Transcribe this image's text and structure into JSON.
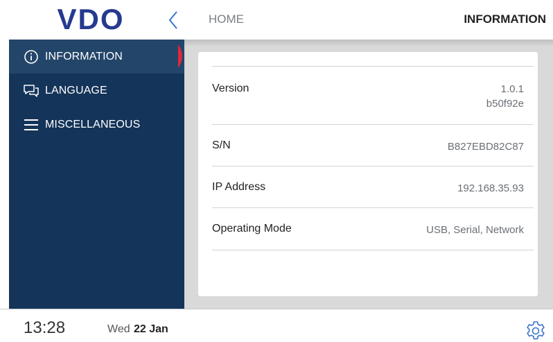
{
  "header": {
    "logo_text": "VDO",
    "breadcrumb_home": "HOME",
    "title": "INFORMATION"
  },
  "sidebar": {
    "items": [
      {
        "label": "INFORMATION",
        "icon": "info-circle-icon",
        "active": true
      },
      {
        "label": "LANGUAGE",
        "icon": "chat-bubbles-icon",
        "active": false
      },
      {
        "label": "MISCELLANEOUS",
        "icon": "menu-lines-icon",
        "active": false
      }
    ]
  },
  "info": {
    "rows": [
      {
        "label": "Version",
        "value": "1.0.1",
        "value2": "b50f92e"
      },
      {
        "label": "S/N",
        "value": "B827EBD82C87"
      },
      {
        "label": "IP Address",
        "value": "192.168.35.93"
      },
      {
        "label": "Operating Mode",
        "value": "USB, Serial, Network"
      }
    ]
  },
  "footer": {
    "time": "13:28",
    "date_day": "Wed",
    "date_rest": "22 Jan"
  },
  "colors": {
    "brand_blue": "#263a8f",
    "sidebar_bg": "#143459",
    "sidebar_active": "#234569",
    "active_marker": "#e0283c",
    "accent_icon": "#3a73c9"
  }
}
